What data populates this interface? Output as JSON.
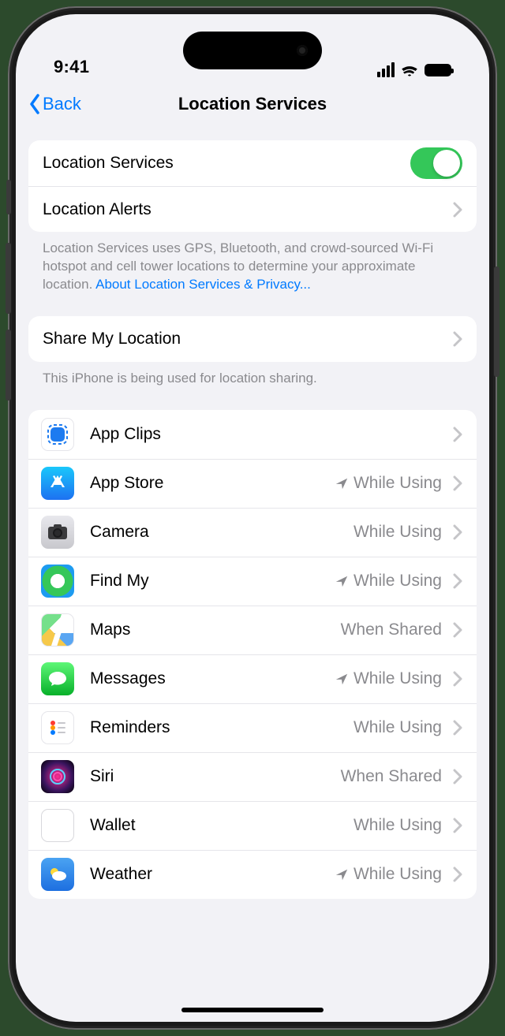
{
  "status": {
    "time": "9:41"
  },
  "nav": {
    "back": "Back",
    "title": "Location Services"
  },
  "group1": {
    "row1_label": "Location Services",
    "row2_label": "Location Alerts"
  },
  "footer1": {
    "text": "Location Services uses GPS, Bluetooth, and crowd-sourced Wi-Fi hotspot and cell tower locations to determine your approximate location. ",
    "link": "About Location Services & Privacy..."
  },
  "group2": {
    "row1_label": "Share My Location"
  },
  "footer2": {
    "text": "This iPhone is being used for location sharing."
  },
  "apps": [
    {
      "name": "App Clips",
      "status": "",
      "arrow": false,
      "icon": "appclips"
    },
    {
      "name": "App Store",
      "status": "While Using",
      "arrow": true,
      "icon": "appstore"
    },
    {
      "name": "Camera",
      "status": "While Using",
      "arrow": false,
      "icon": "camera"
    },
    {
      "name": "Find My",
      "status": "While Using",
      "arrow": true,
      "icon": "findmy"
    },
    {
      "name": "Maps",
      "status": "When Shared",
      "arrow": false,
      "icon": "maps"
    },
    {
      "name": "Messages",
      "status": "While Using",
      "arrow": true,
      "icon": "messages"
    },
    {
      "name": "Reminders",
      "status": "While Using",
      "arrow": false,
      "icon": "reminders"
    },
    {
      "name": "Siri",
      "status": "When Shared",
      "arrow": false,
      "icon": "siri"
    },
    {
      "name": "Wallet",
      "status": "While Using",
      "arrow": false,
      "icon": "wallet"
    },
    {
      "name": "Weather",
      "status": "While Using",
      "arrow": true,
      "icon": "weather"
    }
  ]
}
